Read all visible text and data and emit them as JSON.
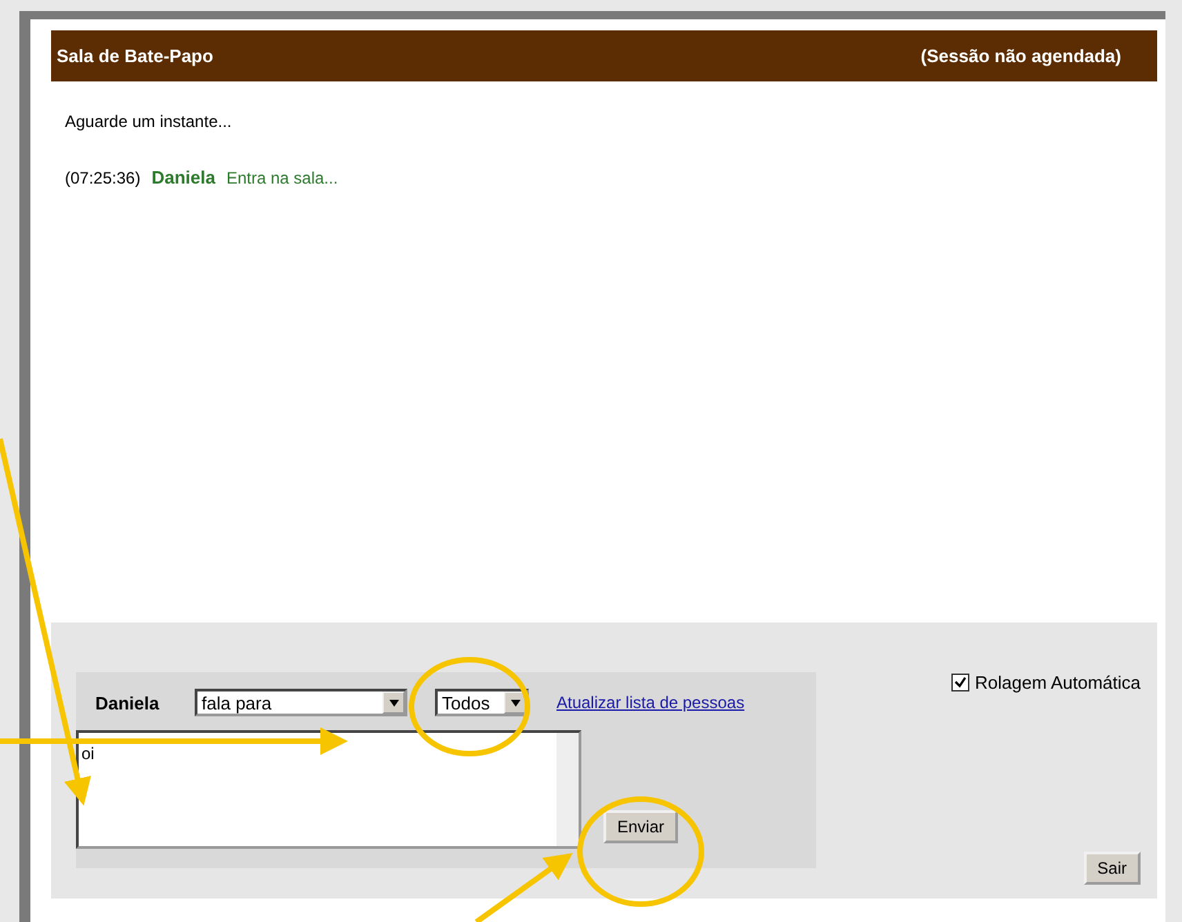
{
  "header": {
    "title": "Sala de Bate-Papo",
    "status": "(Sessão não agendada)"
  },
  "messages": [
    {
      "kind": "system",
      "text": "Aguarde um instante..."
    },
    {
      "kind": "entry",
      "time": "(07:25:36)",
      "user": "Daniela",
      "text": "Entra na sala..."
    }
  ],
  "composer": {
    "user": "Daniela",
    "mode": "fala para",
    "recipient": "Todos",
    "refresh_link": "Atualizar lista de pessoas",
    "message": "oi",
    "send_button": "Enviar"
  },
  "auto_scroll": {
    "label": "Rolagem Automática",
    "checked": true
  },
  "exit_button": "Sair"
}
